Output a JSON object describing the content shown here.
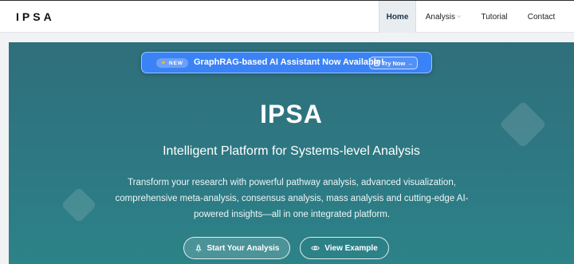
{
  "nav": {
    "brand": "IPSA",
    "items": [
      {
        "label": "Home"
      },
      {
        "label": "Analysis"
      },
      {
        "label": "Tutorial"
      },
      {
        "label": "Contact"
      }
    ]
  },
  "banner": {
    "badge": "NEW",
    "text": "GraphRAG-based AI Assistant Now Available!",
    "button": "Try Now →"
  },
  "hero": {
    "title": "IPSA",
    "subtitle": "Intelligent Platform for Systems-level Analysis",
    "description": "Transform your research with powerful pathway analysis, advanced visualization, comprehensive meta-analysis, consensus analysis, mass analysis and cutting-edge AI-powered insights—all in one integrated platform.",
    "primary_button": "Start Your Analysis",
    "secondary_button": "View Example"
  },
  "colors": {
    "hero_top": "#2f6f7b",
    "hero_bottom": "#2c8488",
    "banner": "#3b82f6",
    "badge_icon": "#fbbf24"
  },
  "icons": {
    "analysis_dropdown": "chevron-down-icon",
    "badge": "sparkle-icon",
    "try_now": "document-icon",
    "start": "rocket-icon",
    "view": "eye-icon"
  }
}
